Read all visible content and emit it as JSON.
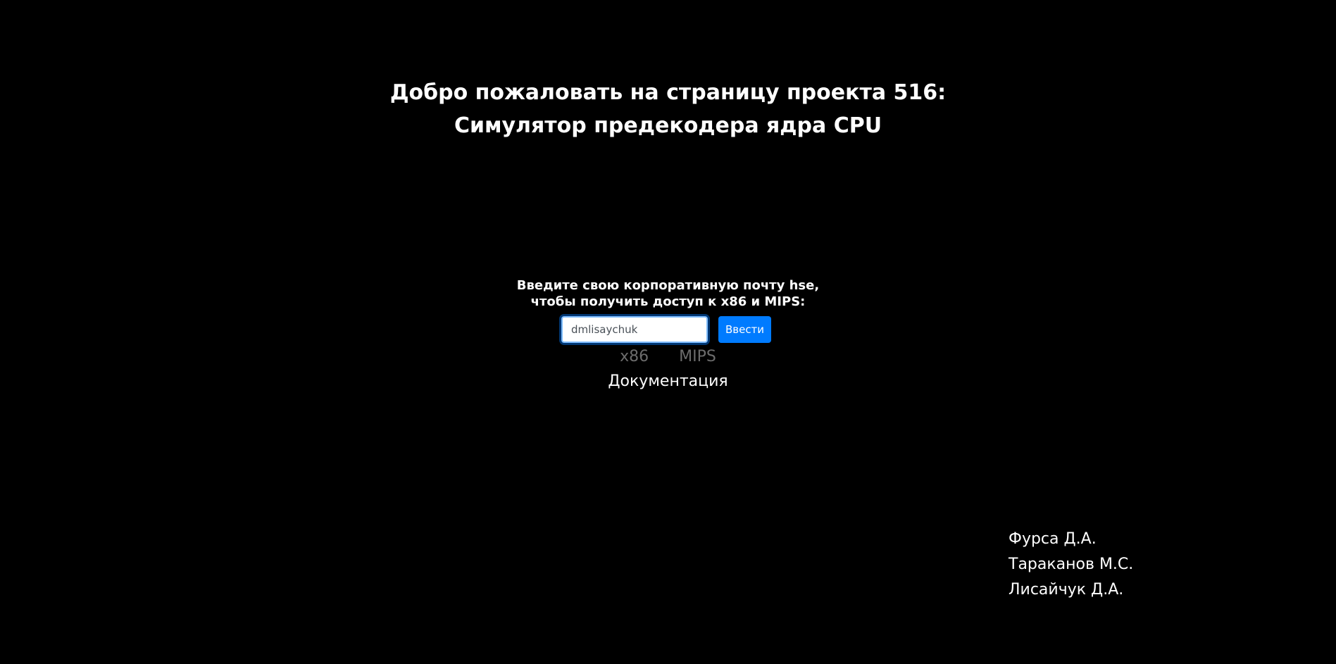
{
  "header": {
    "title_line1": "Добро пожаловать на страницу проекта 516:",
    "title_line2": "Симулятор предекодера ядра CPU"
  },
  "access_form": {
    "prompt_line1": "Введите свою корпоративную почту hse,",
    "prompt_line2": "чтобы получить доступ к x86 и MIPS:",
    "email_value": "dmlisaychuk",
    "submit_label": "Ввести"
  },
  "arch_links": {
    "x86_label": "x86",
    "mips_label": "MIPS"
  },
  "docs": {
    "label": "Документация"
  },
  "authors": [
    "Фурса Д.А.",
    "Тараканов М.С.",
    "Лисайчук Д.А."
  ],
  "colors": {
    "background": "#000000",
    "accent": "#007bff",
    "disabled_link": "#6c6c6c"
  }
}
